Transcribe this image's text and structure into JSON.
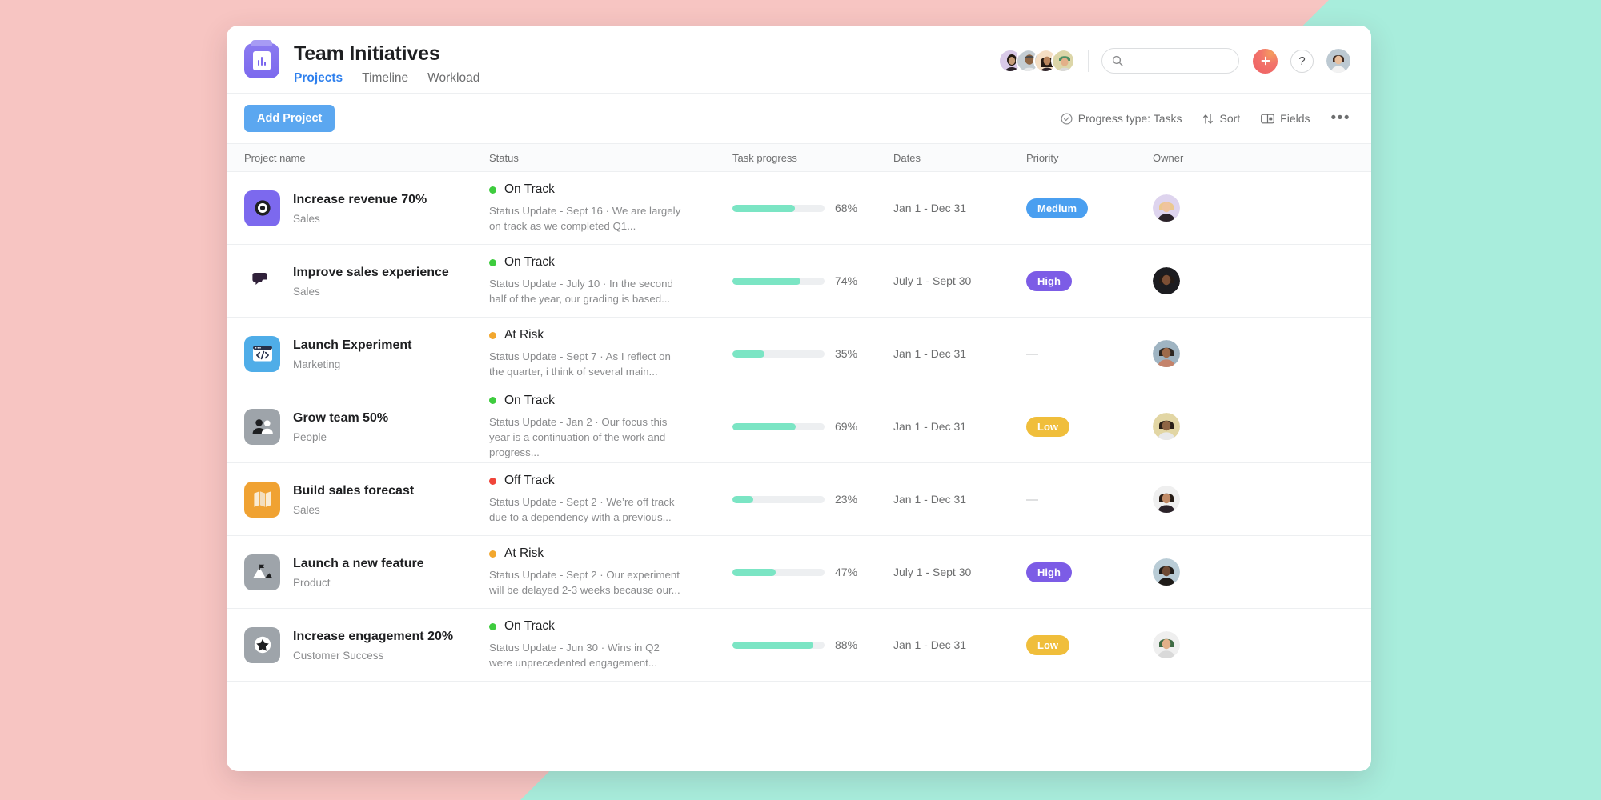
{
  "background": {
    "pink": "#F7C5C2",
    "teal": "#A8EDDC"
  },
  "header": {
    "app_title": "Team Initiatives",
    "logo_icon": "chart-logo-icon",
    "tabs": [
      {
        "label": "Projects",
        "active": true
      },
      {
        "label": "Timeline",
        "active": false
      },
      {
        "label": "Workload",
        "active": false
      }
    ],
    "member_avatars": [
      "member-avatar-1",
      "member-avatar-2",
      "member-avatar-3",
      "member-avatar-4"
    ],
    "search": {
      "value": "",
      "placeholder": "",
      "icon": "search-icon"
    },
    "add_button_icon": "plus-icon",
    "help_button_label": "?",
    "account_avatar": "account-avatar"
  },
  "toolbar": {
    "add_project_label": "Add Project",
    "progress_type_label": "Progress type: Tasks",
    "progress_type_icon": "check-circle-icon",
    "sort_label": "Sort",
    "sort_icon": "sort-arrows-icon",
    "fields_label": "Fields",
    "fields_icon": "fields-icon",
    "more_label": "•••"
  },
  "table": {
    "columns": [
      "Project name",
      "Status",
      "Task progress",
      "Dates",
      "Priority",
      "Owner"
    ],
    "rows": [
      {
        "name": "Increase revenue 70%",
        "team": "Sales",
        "icon": "target-icon",
        "icon_color": "#7C69EE",
        "status": "On Track",
        "status_color": "#3ECC3E",
        "status_desc": "Status Update - Sept 16 · We are largely on track as we completed Q1...",
        "progress": 68,
        "progress_label": "68%",
        "dates": "Jan 1 - Dec 31",
        "priority": "Medium",
        "priority_color": "#4A9FF0",
        "owner": "owner-avatar-1"
      },
      {
        "name": "Improve sales experience",
        "team": "Sales",
        "icon": "chat-bubbles-icon",
        "icon_color": "#D museum",
        "status": "On Track",
        "status_color": "#3ECC3E",
        "status_desc": "Status Update - July 10 · In the second half of the year, our grading is based...",
        "progress": 74,
        "progress_label": "74%",
        "dates": "July 1 - Sept 30",
        "priority": "High",
        "priority_color": "#7C5CE6",
        "owner": "owner-avatar-2"
      },
      {
        "name": "Launch Experiment",
        "team": "Marketing",
        "icon": "code-window-icon",
        "icon_color": "#4FADE8",
        "status": "At Risk",
        "status_color": "#F2A72E",
        "status_desc": "Status Update - Sept 7 · As I reflect on the quarter, i think of several main...",
        "progress": 35,
        "progress_label": "35%",
        "dates": "Jan 1 - Dec 31",
        "priority": "—",
        "priority_color": "",
        "owner": "owner-avatar-3"
      },
      {
        "name": "Grow team 50%",
        "team": "People",
        "icon": "people-icon",
        "icon_color": "#9EA4AA",
        "status": "On Track",
        "status_color": "#3ECC3E",
        "status_desc": "Status Update - Jan 2 · Our focus this year is a continuation of the work and progress...",
        "progress": 69,
        "progress_label": "69%",
        "dates": "Jan 1 - Dec 31",
        "priority": "Low",
        "priority_color": "#F0BE3B",
        "owner": "owner-avatar-4"
      },
      {
        "name": "Build sales forecast",
        "team": "Sales",
        "icon": "map-icon",
        "icon_color": "#F0A232",
        "status": "Off Track",
        "status_color": "#F0453A",
        "status_desc": "Status Update - Sept 2 · We’re off track due to a dependency with a previous...",
        "progress": 23,
        "progress_label": "23%",
        "dates": "Jan 1 - Dec 31",
        "priority": "—",
        "priority_color": "",
        "owner": "owner-avatar-5"
      },
      {
        "name": "Launch a new feature",
        "team": "Product",
        "icon": "mountain-flag-icon",
        "icon_color": "#9EA4AA",
        "status": "At Risk",
        "status_color": "#F2A72E",
        "status_desc": "Status Update - Sept 2 · Our experiment will be delayed 2-3 weeks because our...",
        "progress": 47,
        "progress_label": "47%",
        "dates": "July 1 - Sept 30",
        "priority": "High",
        "priority_color": "#7C5CE6",
        "owner": "owner-avatar-6"
      },
      {
        "name": "Increase engagement 20%",
        "team": "Customer Success",
        "icon": "star-icon",
        "icon_color": "#9EA4AA",
        "status": "On Track",
        "status_color": "#3ECC3E",
        "status_desc": "Status Update - Jun 30 · Wins in Q2 were unprecedented engagement...",
        "progress": 88,
        "progress_label": "88%",
        "dates": "Jan 1 - Dec 31",
        "priority": "Low",
        "priority_color": "#F0BE3B",
        "owner": "owner-avatar-7"
      }
    ]
  }
}
